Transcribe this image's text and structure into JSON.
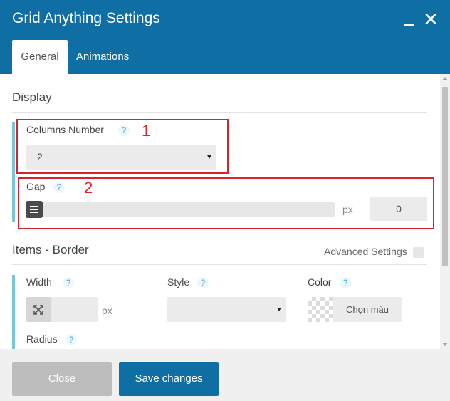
{
  "window": {
    "title": "Grid Anything Settings",
    "minimize_icon": "minimize-icon",
    "close_icon": "close-icon",
    "close_glyph": "✕"
  },
  "tabs": [
    {
      "label": "General",
      "active": true
    },
    {
      "label": "Animations",
      "active": false
    }
  ],
  "display": {
    "title": "Display",
    "columns": {
      "label": "Columns Number",
      "help": "?",
      "value": "2",
      "annotation": "1"
    },
    "gap": {
      "label": "Gap",
      "help": "?",
      "unit": "px",
      "value": "0",
      "slider_value": 0,
      "annotation": "2"
    }
  },
  "items_border": {
    "title": "Items - Border",
    "advanced_label": "Advanced Settings",
    "advanced_checked": false,
    "width": {
      "label": "Width",
      "help": "?",
      "unit": "px",
      "value": ""
    },
    "style": {
      "label": "Style",
      "help": "?",
      "value": ""
    },
    "color": {
      "label": "Color",
      "help": "?",
      "button": "Chọn màu"
    },
    "radius": {
      "label": "Radius",
      "help": "?"
    }
  },
  "footer": {
    "close_label": "Close",
    "save_label": "Save changes"
  },
  "colors": {
    "header": "#0f6fa5",
    "accent": "#77c7d9",
    "annotation_red": "#d9232a",
    "primary_button": "#0f6fa5",
    "disabled_button": "#bdbdbd"
  }
}
